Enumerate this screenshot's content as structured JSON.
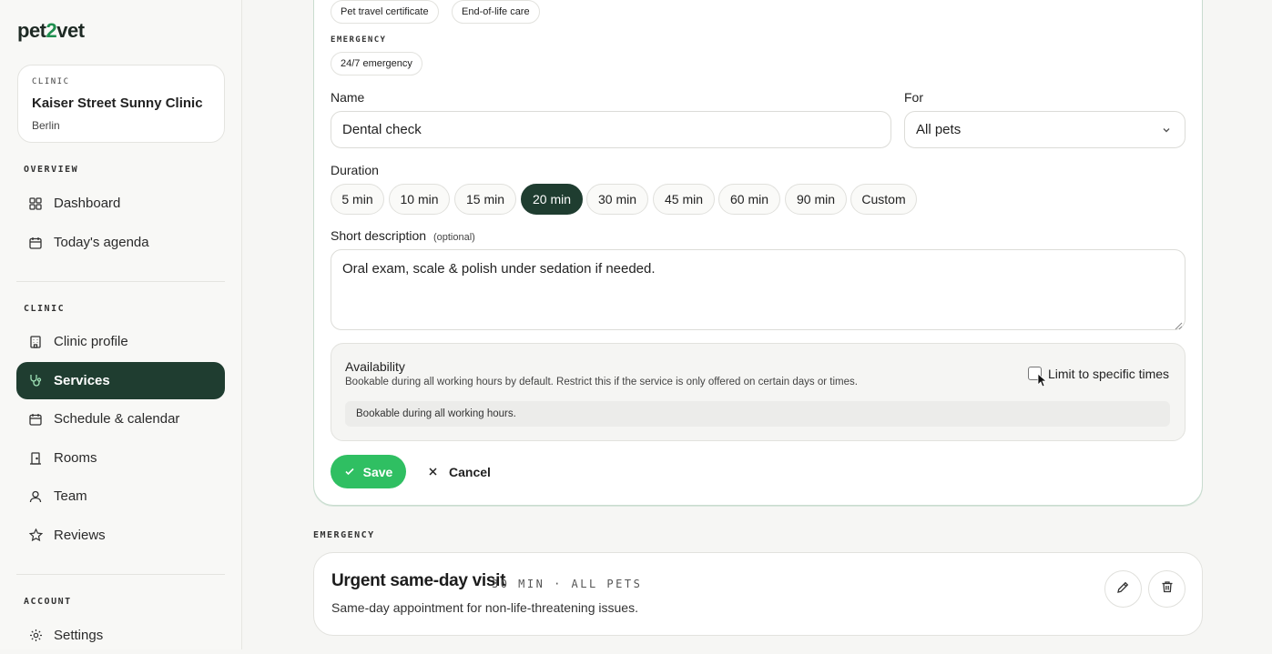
{
  "app": {
    "logo_prefix": "pet",
    "logo_two": "2",
    "logo_suffix": "vet"
  },
  "clinic_card": {
    "label": "CLINIC",
    "name": "Kaiser Street Sunny Clinic",
    "city": "Berlin"
  },
  "sidebar": {
    "overview_title": "OVERVIEW",
    "overview_items": [
      {
        "label": "Dashboard",
        "icon": "grid-icon"
      },
      {
        "label": "Today's agenda",
        "icon": "calendar-icon"
      }
    ],
    "clinic_title": "CLINIC",
    "clinic_items": [
      {
        "label": "Clinic profile",
        "icon": "building-icon"
      },
      {
        "label": "Services",
        "icon": "stethoscope-icon",
        "active": true
      },
      {
        "label": "Schedule & calendar",
        "icon": "calendar-icon"
      },
      {
        "label": "Rooms",
        "icon": "door-icon"
      },
      {
        "label": "Team",
        "icon": "user-icon"
      },
      {
        "label": "Reviews",
        "icon": "star-icon"
      }
    ],
    "account_title": "ACCOUNT",
    "account_items": [
      {
        "label": "Settings",
        "icon": "gear-icon"
      }
    ]
  },
  "form": {
    "top_chips": [
      "Pet travel certificate",
      "End-of-life care"
    ],
    "emergency_label": "EMERGENCY",
    "emergency_chips": [
      "24/7 emergency"
    ],
    "name_label": "Name",
    "name_value": "Dental check",
    "for_label": "For",
    "for_value": "All pets",
    "duration_label": "Duration",
    "durations": [
      "5 min",
      "10 min",
      "15 min",
      "20 min",
      "30 min",
      "45 min",
      "60 min",
      "90 min",
      "Custom"
    ],
    "selected_duration": "20 min",
    "desc_label": "Short description",
    "desc_optional": "(optional)",
    "desc_value": "Oral exam, scale & polish under sedation if needed.",
    "availability_title": "Availability",
    "availability_desc": "Bookable during all working hours by default. Restrict this if the service is only offered on certain days or times.",
    "availability_status": "Bookable during all working hours.",
    "limit_label": "Limit to specific times",
    "limit_checked": false,
    "save_label": "Save",
    "cancel_label": "Cancel",
    "accent": "#2fbf62",
    "dark_green": "#1f3d30"
  },
  "emergency_section": {
    "title": "EMERGENCY",
    "service": {
      "name": "Urgent same-day visit",
      "meta": "30 MIN · ALL PETS",
      "desc": "Same-day appointment for non-life-threatening issues."
    }
  }
}
